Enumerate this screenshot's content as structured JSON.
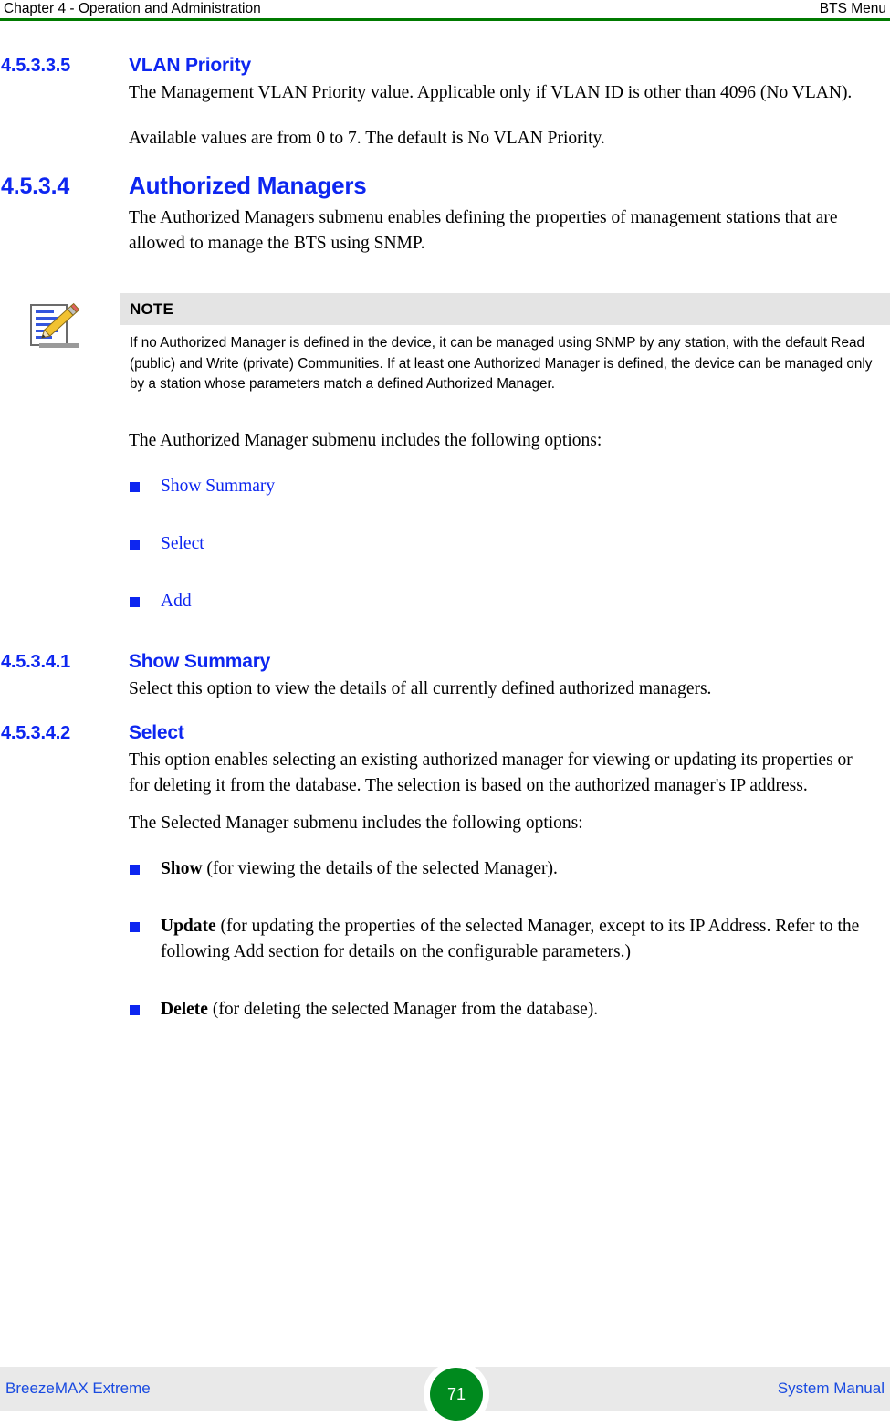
{
  "header": {
    "left": "Chapter 4 - Operation and Administration",
    "right": "BTS Menu",
    "rule_color": "#007A00"
  },
  "theme": {
    "heading_blue": "#0D26F0",
    "link_blue": "#0D26F0",
    "footer_link_blue": "#1A4BE0",
    "note_header_gray": "#E4E4E4",
    "footer_gray": "#E9E9E9",
    "page_badge_green": "#008A1E"
  },
  "sections": {
    "vlan_priority": {
      "number": "4.5.3.3.5",
      "title": "VLAN Priority",
      "paragraphs": [
        "The Management VLAN Priority value. Applicable only if VLAN ID is other than 4096 (No VLAN).",
        "Available values are from 0 to 7. The default is No VLAN Priority."
      ]
    },
    "authorized_managers": {
      "number": "4.5.3.4",
      "title": "Authorized Managers",
      "intro": "The Authorized Managers submenu enables defining the properties of management stations that are allowed to manage the BTS using SNMP.",
      "note": {
        "icon": "notepad-pencil-icon",
        "title": "NOTE",
        "body": "If no Authorized Manager is defined in the device, it can be managed using SNMP by any station, with the default Read (public) and Write (private) Communities. If at least one Authorized Manager is defined, the device can be managed only by a station whose parameters match a defined Authorized Manager."
      },
      "options_intro": "The Authorized Manager submenu includes the following options:",
      "options": [
        {
          "label": "Show Summary"
        },
        {
          "label": "Select"
        },
        {
          "label": "Add"
        }
      ]
    },
    "show_summary": {
      "number": "4.5.3.4.1",
      "title": "Show Summary",
      "paragraphs": [
        "Select this option to view the details of all currently defined authorized managers."
      ]
    },
    "select": {
      "number": "4.5.3.4.2",
      "title": "Select",
      "paragraphs": [
        "This option enables selecting an existing authorized manager for viewing or updating its properties or for deleting it from the database. The selection is based on the authorized manager's IP address.",
        "The Selected Manager submenu includes the following options:"
      ],
      "options": [
        {
          "term": "Show",
          "rest": " (for viewing the details of the selected Manager)."
        },
        {
          "term": "Update",
          "rest": " (for updating the properties of the selected Manager, except to its IP Address. Refer to the following Add section for details on the configurable parameters.)"
        },
        {
          "term": "Delete",
          "rest": " (for deleting the selected Manager from the database)."
        }
      ]
    }
  },
  "footer": {
    "left": "BreezeMAX Extreme",
    "page_number": "71",
    "right": "System Manual"
  }
}
